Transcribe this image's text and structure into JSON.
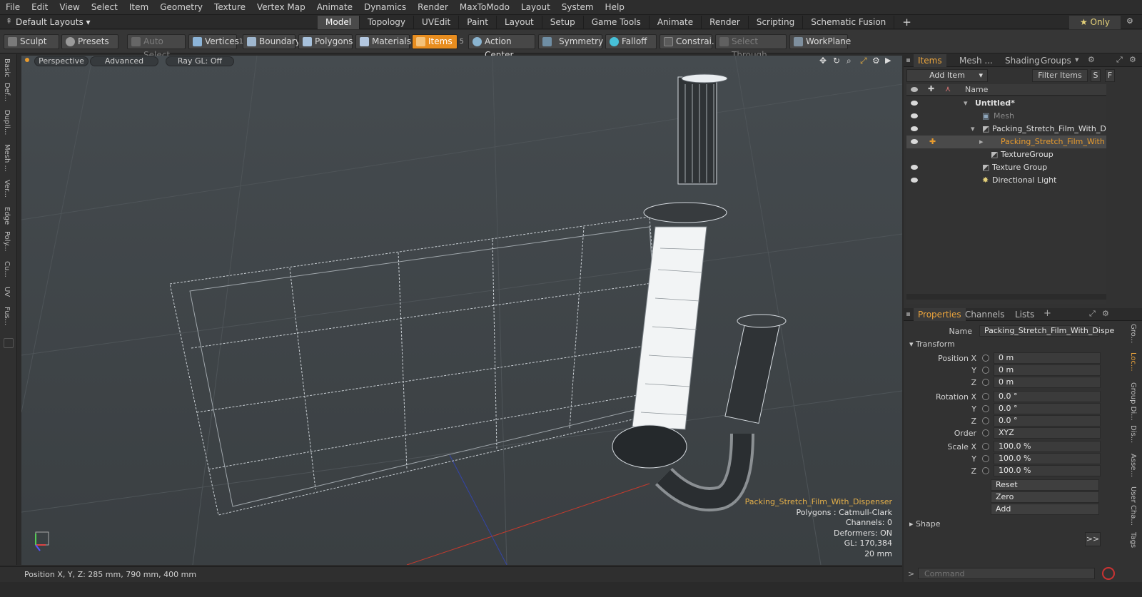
{
  "menu": [
    "File",
    "Edit",
    "View",
    "Select",
    "Item",
    "Geometry",
    "Texture",
    "Vertex Map",
    "Animate",
    "Dynamics",
    "Render",
    "MaxToModo",
    "Layout",
    "System",
    "Help"
  ],
  "layout_selector": "Default Layouts ▾",
  "layout_tabs": [
    "Model",
    "Topology",
    "UVEdit",
    "Paint",
    "Layout",
    "Setup",
    "Game Tools",
    "Animate",
    "Render",
    "Scripting",
    "Schematic Fusion"
  ],
  "only_label": "★  Only",
  "toolbar": {
    "sculpt": "Sculpt",
    "presets": "Presets",
    "auto_select": "Auto Select",
    "vertices": "Vertices",
    "vertices_count": "1",
    "boundary": "Boundary",
    "polygons": "Polygons",
    "materials": "Materials",
    "items": "Items",
    "items_count": "5",
    "action_center": "Action Center",
    "symmetry": "Symmetry",
    "falloff": "Falloff",
    "constraints": "Constrai...",
    "select_through": "Select Through",
    "workplane": "WorkPlane"
  },
  "left_tabs": [
    "Basic",
    "Def...",
    "Dupli...",
    "Mesh ...",
    "Ver...",
    "Edge",
    "Poly...",
    "Cu...",
    "UV",
    "Fus..."
  ],
  "viewport": {
    "perspective": "Perspective",
    "advanced": "Advanced",
    "raygl": "Ray GL: Off",
    "info_name": "Packing_Stretch_Film_With_Dispenser",
    "info_polygons": "Polygons : Catmull-Clark",
    "info_channels": "Channels: 0",
    "info_deformers": "Deformers: ON",
    "info_gl": "GL: 170,384",
    "info_size": "20 mm"
  },
  "status": "Position X, Y, Z:   285 mm, 790 mm, 400 mm",
  "panel_tabs": {
    "items": "Items",
    "mesh": "Mesh ...",
    "shading": "Shading",
    "groups": "Groups"
  },
  "add_item": "Add Item",
  "filter_items": "Filter Items",
  "name_header": "Name",
  "tree": [
    {
      "label": "Untitled*"
    },
    {
      "label": "Mesh"
    },
    {
      "label": "Packing_Stretch_Film_With_Di..."
    },
    {
      "label": "Packing_Stretch_Film_With ..."
    },
    {
      "label": "TextureGroup"
    },
    {
      "label": "Texture Group"
    },
    {
      "label": "Directional Light"
    }
  ],
  "props_tabs": {
    "properties": "Properties",
    "channels": "Channels",
    "lists": "Lists"
  },
  "props": {
    "name_label": "Name",
    "name_value": "Packing_Stretch_Film_With_Dispe",
    "transform": "Transform",
    "position_x_label": "Position X",
    "y_label": "Y",
    "z_label": "Z",
    "rotation_x_label": "Rotation X",
    "order_label": "Order",
    "scale_x_label": "Scale X",
    "pos_x": "0 m",
    "pos_y": "0 m",
    "pos_z": "0 m",
    "rot_x": "0.0 °",
    "rot_y": "0.0 °",
    "rot_z": "0.0 °",
    "order": "XYZ",
    "scale_x": "100.0 %",
    "scale_y": "100.0 %",
    "scale_z": "100.0 %",
    "reset": "Reset",
    "zero": "Zero",
    "add": "Add",
    "shape": "Shape",
    "more": ">>"
  },
  "right_side_tabs": [
    "Gro...",
    "Loc...",
    "Group Di...",
    "Dis...",
    "Asse...",
    "User Cha...",
    "Tags"
  ],
  "command_placeholder": "Command"
}
